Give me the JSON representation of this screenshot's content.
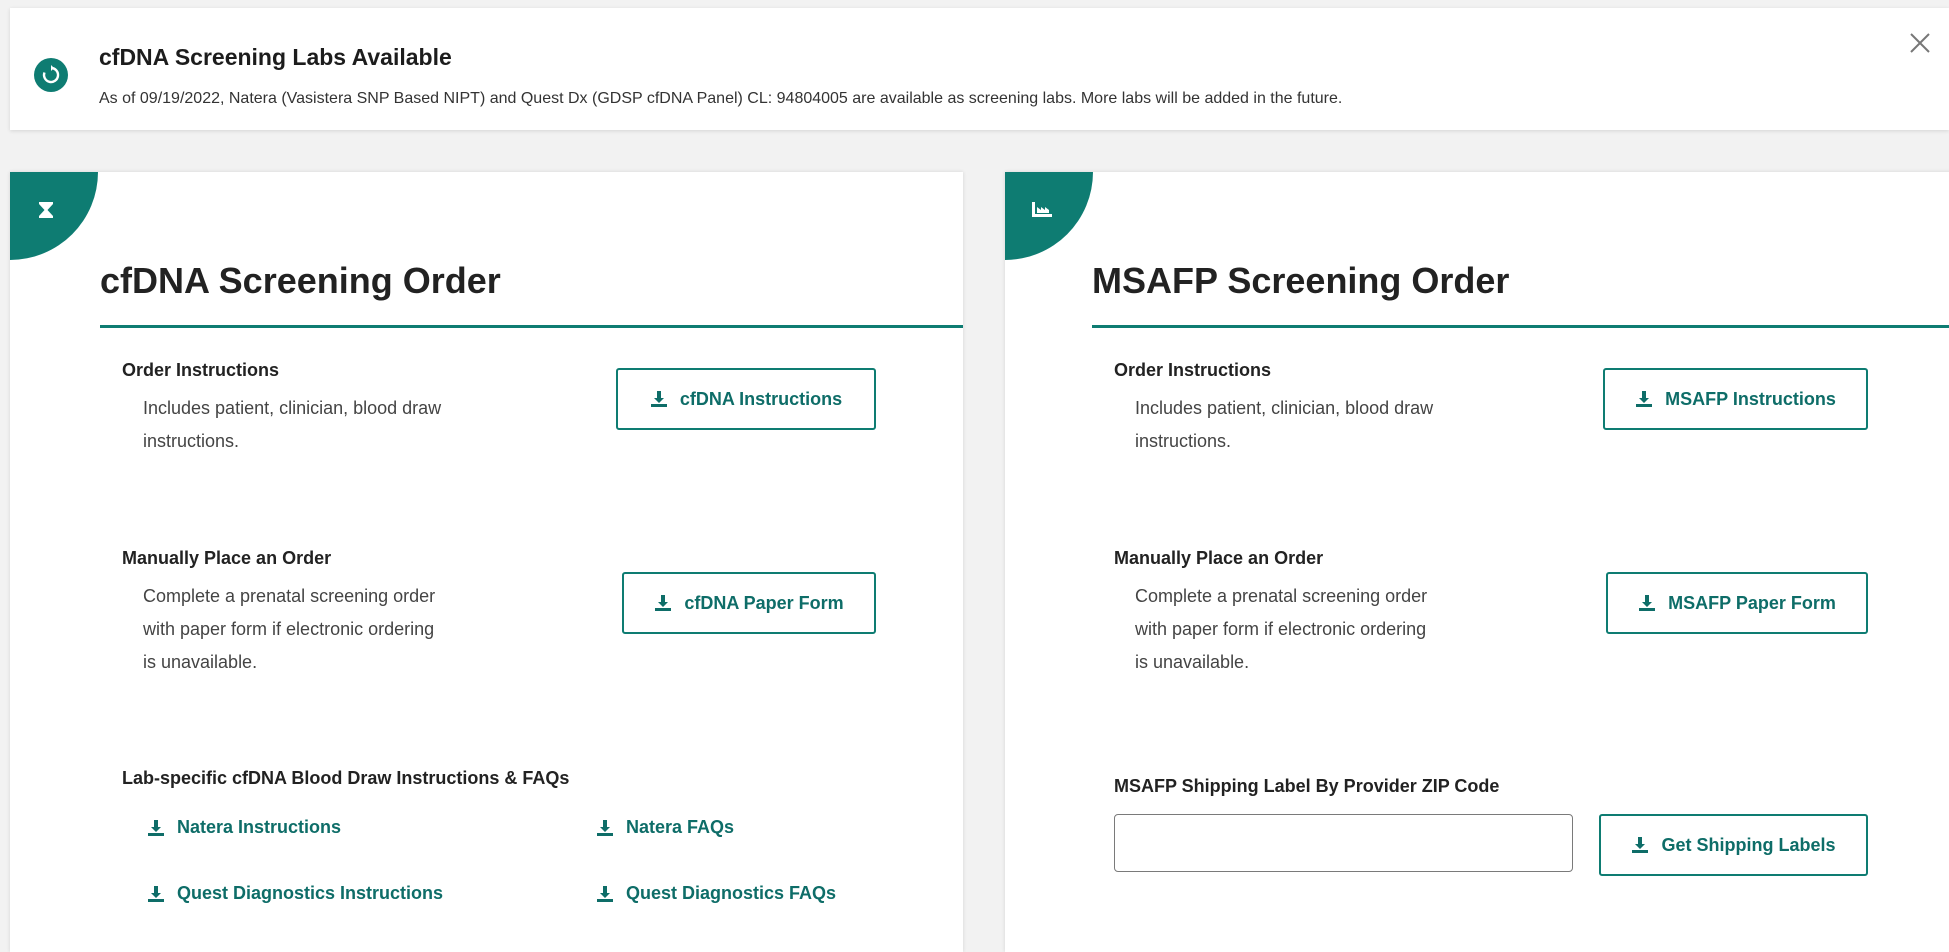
{
  "banner": {
    "icon": "refresh-icon",
    "title": "cfDNA Screening Labs Available",
    "text": "As of 09/19/2022, Natera (Vasistera SNP Based NIPT) and Quest Dx (GDSP cfDNA Panel) CL: 94804005 are available as screening labs. More labs will be added in the future.",
    "close_icon": "close-icon"
  },
  "cfdna": {
    "icon": "hourglass-icon",
    "title": "cfDNA Screening Order",
    "order_instructions": {
      "title": "Order Instructions",
      "desc_line1": "Includes patient, clinician, blood draw",
      "desc_line2": "instructions.",
      "button": "cfDNA Instructions"
    },
    "manual": {
      "title": "Manually Place an Order",
      "desc_line1": "Complete a prenatal screening order",
      "desc_line2": "with paper form if electronic ordering",
      "desc_line3": "is unavailable.",
      "button": "cfDNA Paper Form"
    },
    "lab_specific": {
      "title": "Lab-specific cfDNA Blood Draw Instructions & FAQs",
      "links": [
        "Natera Instructions",
        "Natera FAQs",
        "Quest Diagnostics Instructions",
        "Quest Diagnostics FAQs"
      ]
    }
  },
  "msafp": {
    "icon": "factory-icon",
    "title": "MSAFP Screening Order",
    "order_instructions": {
      "title": "Order Instructions",
      "desc_line1": "Includes patient, clinician, blood draw",
      "desc_line2": "instructions.",
      "button": "MSAFP Instructions"
    },
    "manual": {
      "title": "Manually Place an Order",
      "desc_line1": "Complete a prenatal screening order",
      "desc_line2": "with paper form if electronic ordering",
      "desc_line3": "is unavailable.",
      "button": "MSAFP Paper Form"
    },
    "shipping": {
      "title": "MSAFP Shipping Label By Provider ZIP Code",
      "input_value": "",
      "button": "Get Shipping Labels"
    }
  },
  "colors": {
    "accent": "#0e7c72",
    "accent_text": "#0e6d68",
    "background": "#f2f2f2"
  }
}
